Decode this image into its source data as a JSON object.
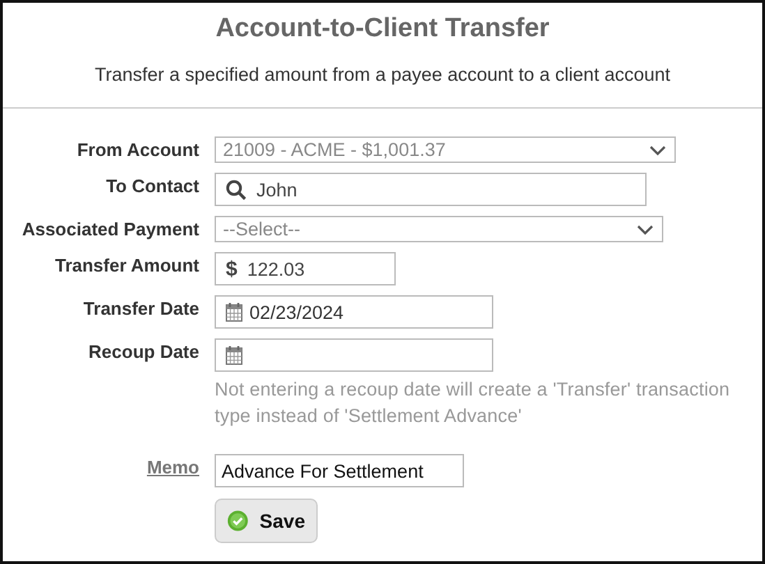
{
  "title": "Account-to-Client Transfer",
  "subtitle": "Transfer a specified amount from a payee account to a client account",
  "fields": [
    {
      "label": "From Account",
      "kind": "select",
      "value": "21009 - ACME - $1,001.37",
      "link": false
    },
    {
      "label": "To Contact",
      "kind": "search",
      "value": "John",
      "link": false
    },
    {
      "label": "Associated Payment",
      "kind": "select",
      "placeholder": "--Select--",
      "link": false
    },
    {
      "label": "Transfer Amount",
      "kind": "money",
      "value": "122.03",
      "link": false
    },
    {
      "label": "Transfer Date",
      "kind": "date",
      "value": "02/23/2024",
      "link": false
    },
    {
      "label": "Recoup Date",
      "kind": "date",
      "link": false,
      "hint": "Not entering a recoup date will create a 'Transfer' transaction type instead of 'Settlement Advance'"
    },
    {
      "label": "Memo",
      "kind": "text",
      "value": "Advance For Settlement",
      "link": true
    }
  ],
  "currency_symbol": "$",
  "save_button": "Save"
}
